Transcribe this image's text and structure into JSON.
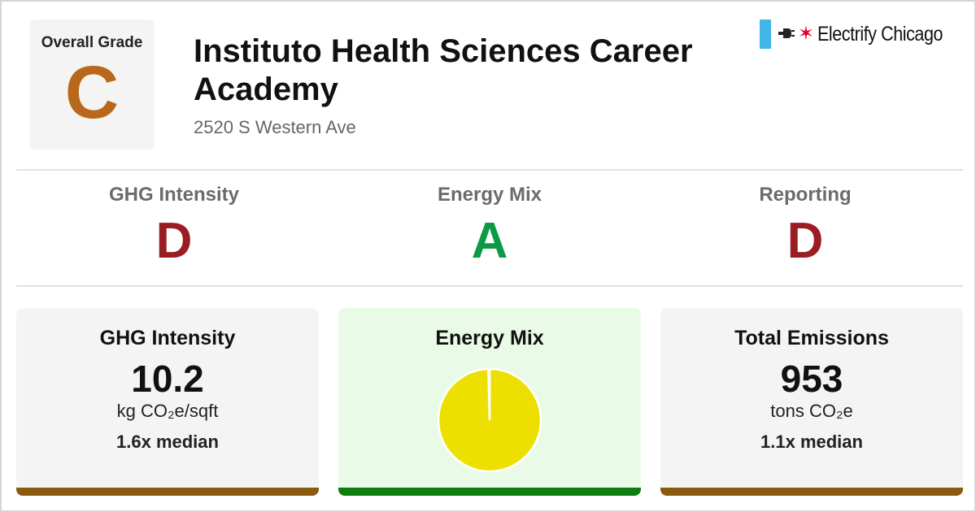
{
  "overall": {
    "label": "Overall Grade",
    "grade": "C",
    "grade_color": "#b8681a"
  },
  "building": {
    "name": "Instituto Health Sciences Career Academy",
    "address": "2520 S Western Ave"
  },
  "brand": {
    "name": "Electrify Chicago",
    "plug_icon": "plug-icon",
    "star_icon": "chicago-star-icon",
    "flag_color": "#41b6e6",
    "star_color": "#e4002b"
  },
  "subgrades": [
    {
      "label": "GHG Intensity",
      "grade": "D",
      "color": "#9b1c22"
    },
    {
      "label": "Energy Mix",
      "grade": "A",
      "color": "#0d9a45"
    },
    {
      "label": "Reporting",
      "grade": "D",
      "color": "#9b1c22"
    }
  ],
  "cards": {
    "ghg": {
      "title": "GHG Intensity",
      "value": "10.2",
      "unit": "kg CO₂e/sqft",
      "median": "1.6x median",
      "bar_color": "#8b5a0e"
    },
    "energy": {
      "title": "Energy Mix",
      "bg_color": "#e9fbe6",
      "bar_color": "#0d7d10"
    },
    "emissions": {
      "title": "Total Emissions",
      "value": "953",
      "unit": "tons CO₂e",
      "median": "1.1x median",
      "bar_color": "#8b5a0e"
    }
  },
  "chart_data": {
    "type": "pie",
    "slices": [
      {
        "value": 99.6,
        "color": "#ede000"
      },
      {
        "value": 0.4,
        "color": "#ffffff"
      }
    ]
  }
}
